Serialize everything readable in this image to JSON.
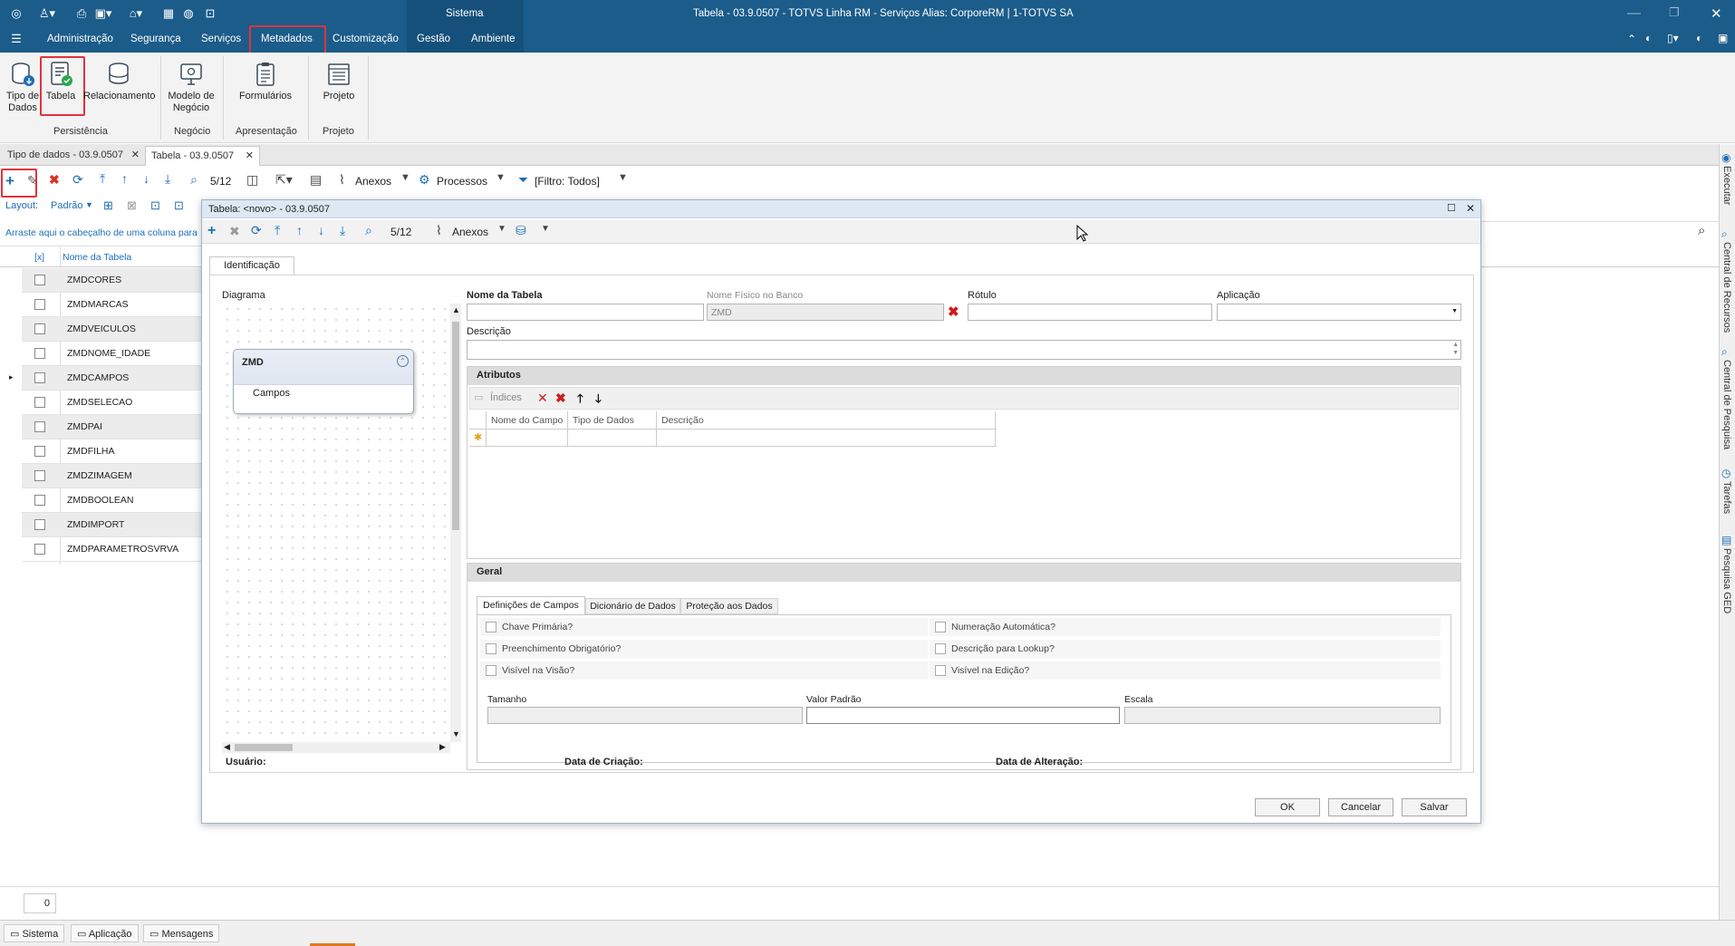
{
  "window": {
    "title": "Tabela - 03.9.0507 - TOTVS Linha RM - Serviços  Alias: CorporeRM | 1-TOTVS SA",
    "system_label": "Sistema"
  },
  "menu": [
    {
      "label": "Administração"
    },
    {
      "label": "Segurança"
    },
    {
      "label": "Serviços"
    },
    {
      "label": "Metadados"
    },
    {
      "label": "Customização"
    },
    {
      "label": "Gestão"
    },
    {
      "label": "Ambiente"
    }
  ],
  "ribbon": {
    "buttons": [
      {
        "label": "Tipo de Dados",
        "icon": "database-download-icon"
      },
      {
        "label": "Tabela",
        "icon": "table-check-icon"
      },
      {
        "label": "Relacionamento",
        "icon": "database-relation-icon"
      },
      {
        "label": "Modelo de Negócio",
        "icon": "monitor-icon"
      },
      {
        "label": "Formulários",
        "icon": "clipboard-icon"
      },
      {
        "label": "Projeto",
        "icon": "project-window-icon"
      }
    ],
    "groups": [
      "Persistência",
      "Negócio",
      "Apresentação",
      "Projeto"
    ]
  },
  "doc_tabs": [
    {
      "label": "Tipo de dados - 03.9.0507"
    },
    {
      "label": "Tabela - 03.9.0507"
    }
  ],
  "main_toolbar": {
    "counter": "5/12",
    "anexos": "Anexos",
    "processos": "Processos",
    "filtro": "[Filtro: Todos]"
  },
  "layout_bar": {
    "layout_label": "Layout:",
    "layout_value": "Padrão"
  },
  "group_hint": "Arraste aqui o cabeçalho de uma coluna para",
  "grid": {
    "col_check": "[x]",
    "col_name": "Nome da Tabela",
    "rows": [
      "ZMDCORES",
      "ZMDMARCAS",
      "ZMDVEICULOS",
      "ZMDNOME_IDADE",
      "ZMDCAMPOS",
      "ZMDSELECAO",
      "ZMDPAI",
      "ZMDFILHA",
      "ZMDZIMAGEM",
      "ZMDBOOLEAN",
      "ZMDIMPORT",
      "ZMDPARAMETROSVRVA"
    ],
    "current_row": 4
  },
  "record_count": "0",
  "dialog": {
    "title": "Tabela: <novo> - 03.9.0507",
    "counter": "5/12",
    "anexos": "Anexos",
    "tab": "Identificação",
    "diagram_label": "Diagrama",
    "entity_name": "ZMD",
    "entity_item": "Campos",
    "fields": {
      "nome_tabela_label": "Nome da Tabela",
      "nome_tabela_value": "",
      "nome_fisico_label": "Nome Físico no Banco",
      "nome_fisico_value": "ZMD",
      "rotulo_label": "Rótulo",
      "aplicacao_label": "Aplicação",
      "descricao_label": "Descrição"
    },
    "atributos": {
      "title": "Atributos",
      "indices": "Índices",
      "columns": [
        "Nome do Campo",
        "Tipo de Dados",
        "Descrição"
      ]
    },
    "geral": {
      "title": "Geral",
      "tabs": [
        "Definições de Campos",
        "Dicionário de Dados",
        "Proteção aos Dados"
      ],
      "checks_left": [
        "Chave Primária?",
        "Preenchimento Obrigatório?",
        "Visível na Visão?"
      ],
      "checks_right": [
        "Numeração Automática?",
        "Descrição para Lookup?",
        "Visível na Edição?"
      ],
      "tamanho": "Tamanho",
      "valor_padrao": "Valor Padrão",
      "escala": "Escala"
    },
    "footer": {
      "usuario": "Usuário:",
      "data_criacao": "Data de Criação:",
      "data_alteracao": "Data de Alteração:"
    },
    "buttons": {
      "ok": "OK",
      "cancelar": "Cancelar",
      "salvar": "Salvar"
    }
  },
  "right_sidebar": [
    "Executar",
    "Central de Recursos",
    "Central de Pesquisa",
    "Tarefas",
    "Pesquisa GED"
  ],
  "status_tabs": [
    "Sistema",
    "Aplicação",
    "Mensagens"
  ],
  "colors": {
    "titlebar": "#1b5c8a",
    "highlight": "#e0333a",
    "accent_blue": "#1d6fb8"
  }
}
